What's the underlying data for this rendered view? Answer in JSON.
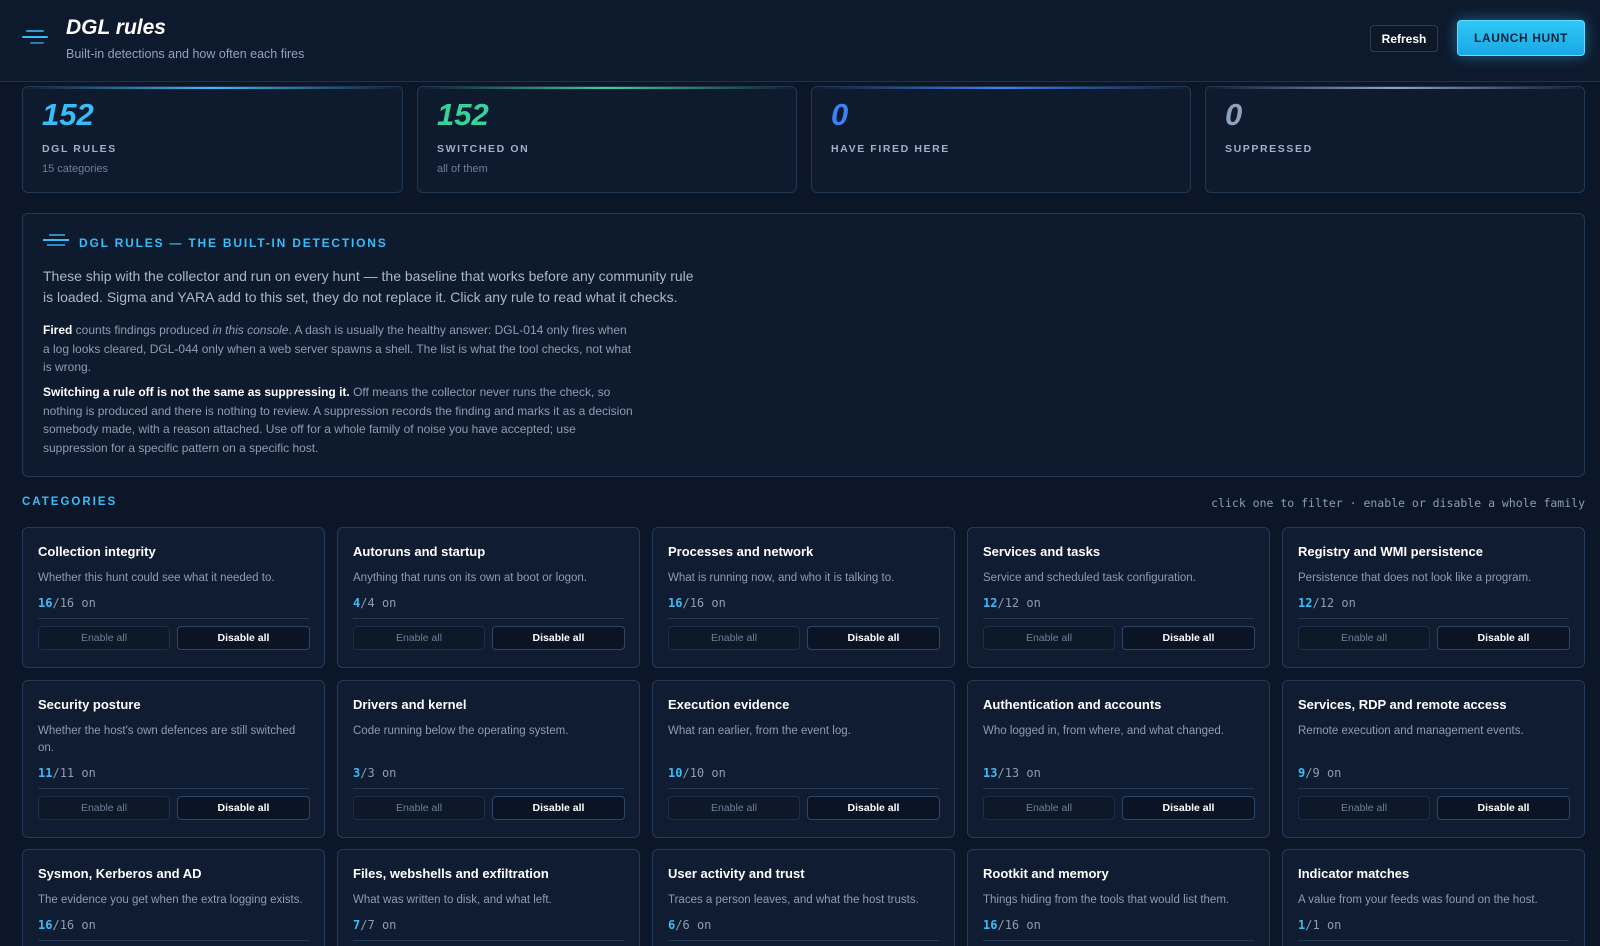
{
  "header": {
    "title": "DGL rules",
    "subtitle": "Built-in detections and how often each fires",
    "refresh_label": "Refresh",
    "launch_label": "LAUNCH HUNT"
  },
  "stats": [
    {
      "value": "152",
      "label": "DGL RULES",
      "sub": "15 categories",
      "color": "#38bdf8"
    },
    {
      "value": "152",
      "label": "SWITCHED ON",
      "sub": "all of them",
      "color": "#34d399"
    },
    {
      "value": "0",
      "label": "HAVE FIRED HERE",
      "sub": "",
      "color": "#3b82f6"
    },
    {
      "value": "0",
      "label": "SUPPRESSED",
      "sub": "",
      "color": "#8fa2bb"
    }
  ],
  "about": {
    "title": "DGL RULES — THE BUILT-IN DETECTIONS",
    "lead": "These ship with the collector and run on every hunt — the baseline that works before any community rule is loaded. Sigma and YARA add to this set, they do not replace it. Click any rule to read what it checks.",
    "p1_bold": "Fired",
    "p1_pre": " counts findings produced ",
    "p1_italic": "in this console",
    "p1_post": ". A dash is usually the healthy answer: DGL-014 only fires when a log looks cleared, DGL-044 only when a web server spawns a shell. The list is what the tool checks, not what is wrong.",
    "p2_bold": "Switching a rule off is not the same as suppressing it.",
    "p2_text": " Off means the collector never runs the check, so nothing is produced and there is nothing to review. A suppression records the finding and marks it as a decision somebody made, with a reason attached. Use off for a whole family of noise you have accepted; use suppression for a specific pattern on a specific host."
  },
  "categories": {
    "heading": "CATEGORIES",
    "hint": "click one to filter · enable or disable a whole family",
    "enable_label": "Enable all",
    "disable_label": "Disable all",
    "on_label": "on",
    "items": [
      {
        "name": "Collection integrity",
        "desc": "Whether this hunt could see what it needed to.",
        "on": "16",
        "total": "16"
      },
      {
        "name": "Autoruns and startup",
        "desc": "Anything that runs on its own at boot or logon.",
        "on": "4",
        "total": "4"
      },
      {
        "name": "Processes and network",
        "desc": "What is running now, and who it is talking to.",
        "on": "16",
        "total": "16"
      },
      {
        "name": "Services and tasks",
        "desc": "Service and scheduled task configuration.",
        "on": "12",
        "total": "12"
      },
      {
        "name": "Registry and WMI persistence",
        "desc": "Persistence that does not look like a program.",
        "on": "12",
        "total": "12"
      },
      {
        "name": "Security posture",
        "desc": "Whether the host's own defences are still switched on.",
        "on": "11",
        "total": "11"
      },
      {
        "name": "Drivers and kernel",
        "desc": "Code running below the operating system.",
        "on": "3",
        "total": "3"
      },
      {
        "name": "Execution evidence",
        "desc": "What ran earlier, from the event log.",
        "on": "10",
        "total": "10"
      },
      {
        "name": "Authentication and accounts",
        "desc": "Who logged in, from where, and what changed.",
        "on": "13",
        "total": "13"
      },
      {
        "name": "Services, RDP and remote access",
        "desc": "Remote execution and management events.",
        "on": "9",
        "total": "9"
      },
      {
        "name": "Sysmon, Kerberos and AD",
        "desc": "The evidence you get when the extra logging exists.",
        "on": "16",
        "total": "16"
      },
      {
        "name": "Files, webshells and exfiltration",
        "desc": "What was written to disk, and what left.",
        "on": "7",
        "total": "7"
      },
      {
        "name": "User activity and trust",
        "desc": "Traces a person leaves, and what the host trusts.",
        "on": "6",
        "total": "6"
      },
      {
        "name": "Rootkit and memory",
        "desc": "Things hiding from the tools that would list them.",
        "on": "16",
        "total": "16"
      },
      {
        "name": "Indicator matches",
        "desc": "A value from your feeds was found on the host.",
        "on": "1",
        "total": "1"
      }
    ]
  }
}
